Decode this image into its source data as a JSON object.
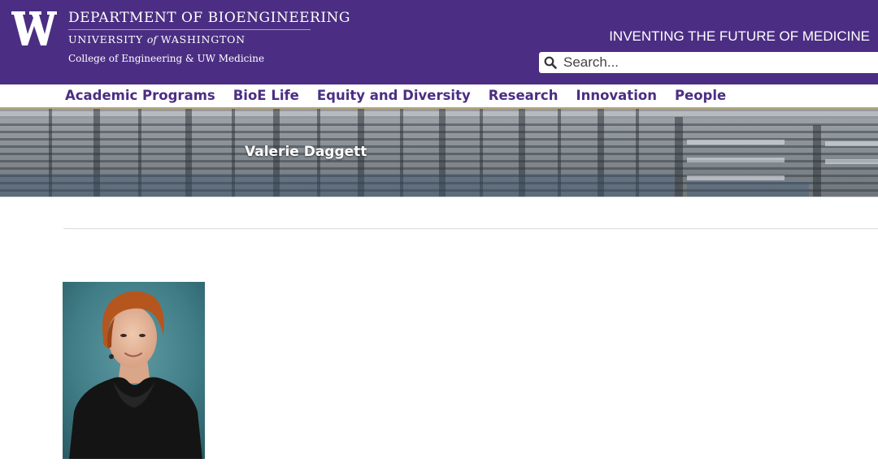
{
  "header": {
    "logo_letter": "W",
    "department": "DEPARTMENT OF BIOENGINEERING",
    "university_pre": "UNIVERSITY",
    "university_of": "of",
    "university_post": "WASHINGTON",
    "college": "College of Engineering & UW Medicine",
    "tagline": "INVENTING THE FUTURE OF MEDICINE",
    "search": {
      "placeholder": "Search...",
      "icon": "search-icon"
    }
  },
  "nav": {
    "items": [
      "Academic Programs",
      "BioE Life",
      "Equity and Diversity",
      "Research",
      "Innovation",
      "People"
    ]
  },
  "banner": {
    "title": "Valerie Daggett"
  },
  "profile": {
    "photo": "portrait-photo"
  },
  "colors": {
    "purple": "#4b2e83",
    "gold": "#b7a57a"
  }
}
